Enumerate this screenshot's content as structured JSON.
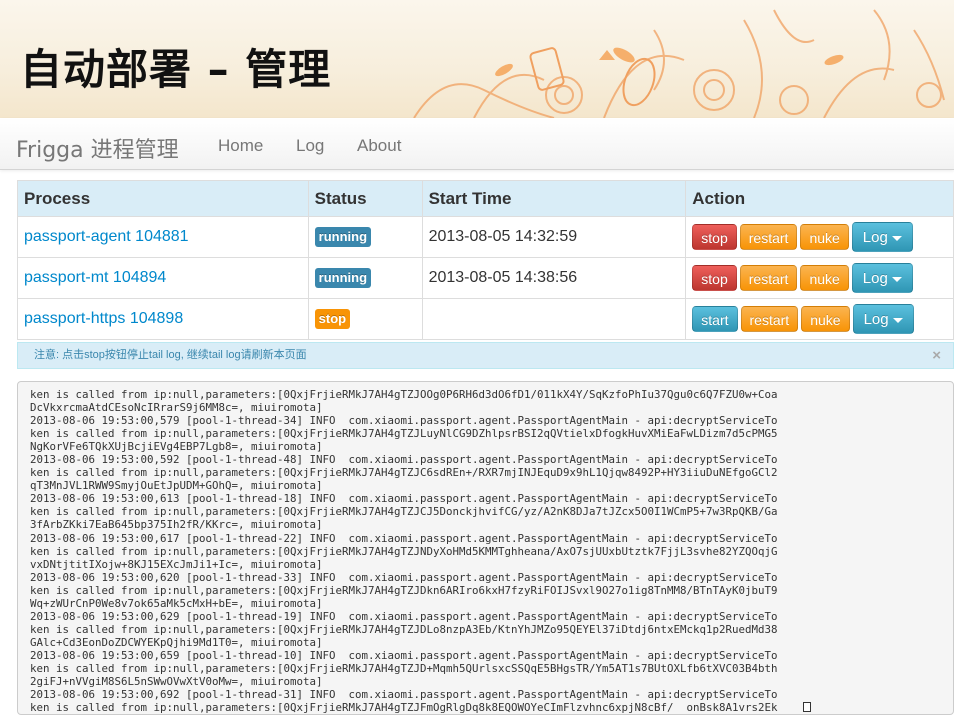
{
  "slide": {
    "title": "自动部署 – 管理"
  },
  "navbar": {
    "brand": "Frigga 进程管理",
    "links": [
      "Home",
      "Log",
      "About"
    ]
  },
  "table": {
    "headers": [
      "Process",
      "Status",
      "Start Time",
      "Action"
    ],
    "rows": [
      {
        "process": "passport-agent 104881",
        "status": "running",
        "start_time": "2013-08-05 14:32:59",
        "actions": [
          "stop",
          "restart",
          "nuke",
          "Log"
        ]
      },
      {
        "process": "passport-mt 104894",
        "status": "running",
        "start_time": "2013-08-05 14:38:56",
        "actions": [
          "stop",
          "restart",
          "nuke",
          "Log"
        ]
      },
      {
        "process": "passport-https 104898",
        "status": "stop",
        "start_time": "",
        "actions": [
          "start",
          "restart",
          "nuke",
          "Log"
        ]
      }
    ]
  },
  "alert": {
    "text": "注意: 点击stop按钮停止tail log, 继续tail log请刷新本页面",
    "close": "×"
  },
  "log": {
    "lines": [
      "ken is called from ip:null,parameters:[0QxjFrjieRMkJ7AH4gTZJOOg0P6RH6d3dO6fD1/011kX4Y/SqKzfoPhIu37Qgu0c6Q7FZU0w+Coa",
      "DcVkxrcmaAtdCEsoNcIRrarS9j6MM8c=, miuiromota]",
      "2013-08-06 19:53:00,579 [pool-1-thread-34] INFO  com.xiaomi.passport.agent.PassportAgentMain - api:decryptServiceTo",
      "ken is called from ip:null,parameters:[0QxjFrjieRMkJ7AH4gTZJLuyNlCG9DZhlpsrBSI2qQVtielxDfogkHuvXMiEaFwLDizm7d5cPMG5",
      "NgKorVFe6TQkXUjBcjiEVg4EBP7Lgb8=, miuiromota]",
      "2013-08-06 19:53:00,592 [pool-1-thread-48] INFO  com.xiaomi.passport.agent.PassportAgentMain - api:decryptServiceTo",
      "ken is called from ip:null,parameters:[0QxjFrjieRMkJ7AH4gTZJC6sdREn+/RXR7mjINJEquD9x9hL1Qjqw8492P+HY3iiuDuNEfgoGCl2",
      "qT3MnJVL1RWW9SmyjOuEtJpUDM+GOhQ=, miuiromota]",
      "2013-08-06 19:53:00,613 [pool-1-thread-18] INFO  com.xiaomi.passport.agent.PassportAgentMain - api:decryptServiceTo",
      "ken is called from ip:null,parameters:[0QxjFrjieRMkJ7AH4gTZJCJ5DonckjhvifCG/yz/A2nK8DJa7tJZcx5O0I1WCmP5+7w3RpQKB/Ga",
      "3fArbZKki7EaB645bp375Ih2fR/KKrc=, miuiromota]",
      "2013-08-06 19:53:00,617 [pool-1-thread-22] INFO  com.xiaomi.passport.agent.PassportAgentMain - api:decryptServiceTo",
      "ken is called from ip:null,parameters:[0QxjFrjieRMkJ7AH4gTZJNDyXoHMd5KMMTghheana/AxO7sjUUxbUtztk7FjjL3svhe82YZQOqjG",
      "vxDNtjtitIXojw+8KJ15EXcJmJi1+Ic=, miuiromota]",
      "2013-08-06 19:53:00,620 [pool-1-thread-33] INFO  com.xiaomi.passport.agent.PassportAgentMain - api:decryptServiceTo",
      "ken is called from ip:null,parameters:[0QxjFrjieRMkJ7AH4gTZJDkn6ARIro6kxH7fzyRiFOIJSvxl9O27o1ig8TnMM8/BTnTAyK0jbuT9",
      "Wq+zWUrCnP0We8v7ok65aMk5cMxH+bE=, miuiromota]",
      "2013-08-06 19:53:00,629 [pool-1-thread-19] INFO  com.xiaomi.passport.agent.PassportAgentMain - api:decryptServiceTo",
      "ken is called from ip:null,parameters:[0QxjFrjieRMkJ7AH4gTZJDLo8nzpA3Eb/KtnYhJMZo95QEYEl37iDtdj6ntxEMckq1p2RuedMd38",
      "GAlc+Cd3EonDoZDCWYEKpQjhi9Md1T0=, miuiromota]",
      "2013-08-06 19:53:00,659 [pool-1-thread-10] INFO  com.xiaomi.passport.agent.PassportAgentMain - api:decryptServiceTo",
      "ken is called from ip:null,parameters:[0QxjFrjieRMkJ7AH4gTZJD+Mqmh5QUrlsxcSSQqE5BHgsTR/Ym5AT1s7BUtOXLfb6tXVC03B4bth",
      "2giFJ+nVVgiM8S6L5nSWwOVwXtV0oMw=, miuiromota]",
      "2013-08-06 19:53:00,692 [pool-1-thread-31] INFO  com.xiaomi.passport.agent.PassportAgentMain - api:decryptServiceTo",
      "ken is called from ip:null,parameters:[0QxjFrjieRMkJ7AH4gTZJFmOgRlgDq8k8EQOWOYeCImFlzvhnc6xpjN8cBf/  onBsk8A1vrs2Ek"
    ]
  }
}
